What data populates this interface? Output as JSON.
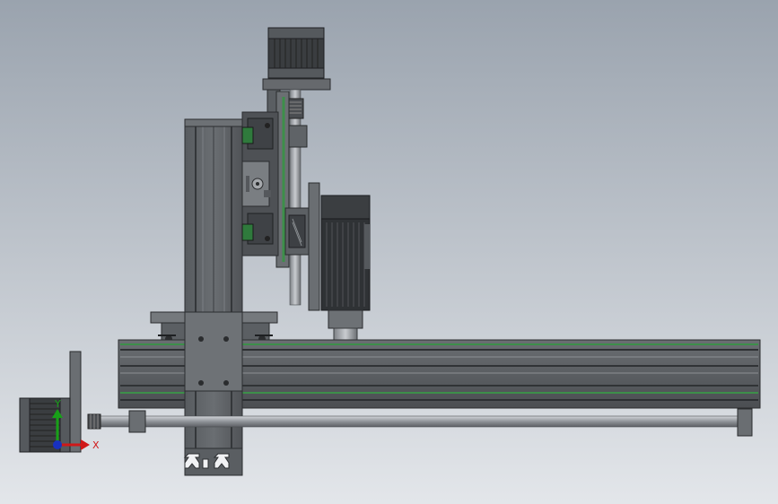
{
  "viewport": {
    "background_top": "#9aa3ae",
    "background_bottom": "#e3e6ea"
  },
  "model": {
    "description_icon": "cad-assembly",
    "frame_color": "#5c6064",
    "frame_dark": "#3d4044",
    "frame_light": "#9ba0a5",
    "accent_green": "#3d8f4a",
    "motor_dark": "#2f3235"
  },
  "triad": {
    "x_label": "X",
    "y_label": "Y",
    "x_color": "#d01818",
    "y_color": "#18a018",
    "z_color": "#1830c0"
  }
}
